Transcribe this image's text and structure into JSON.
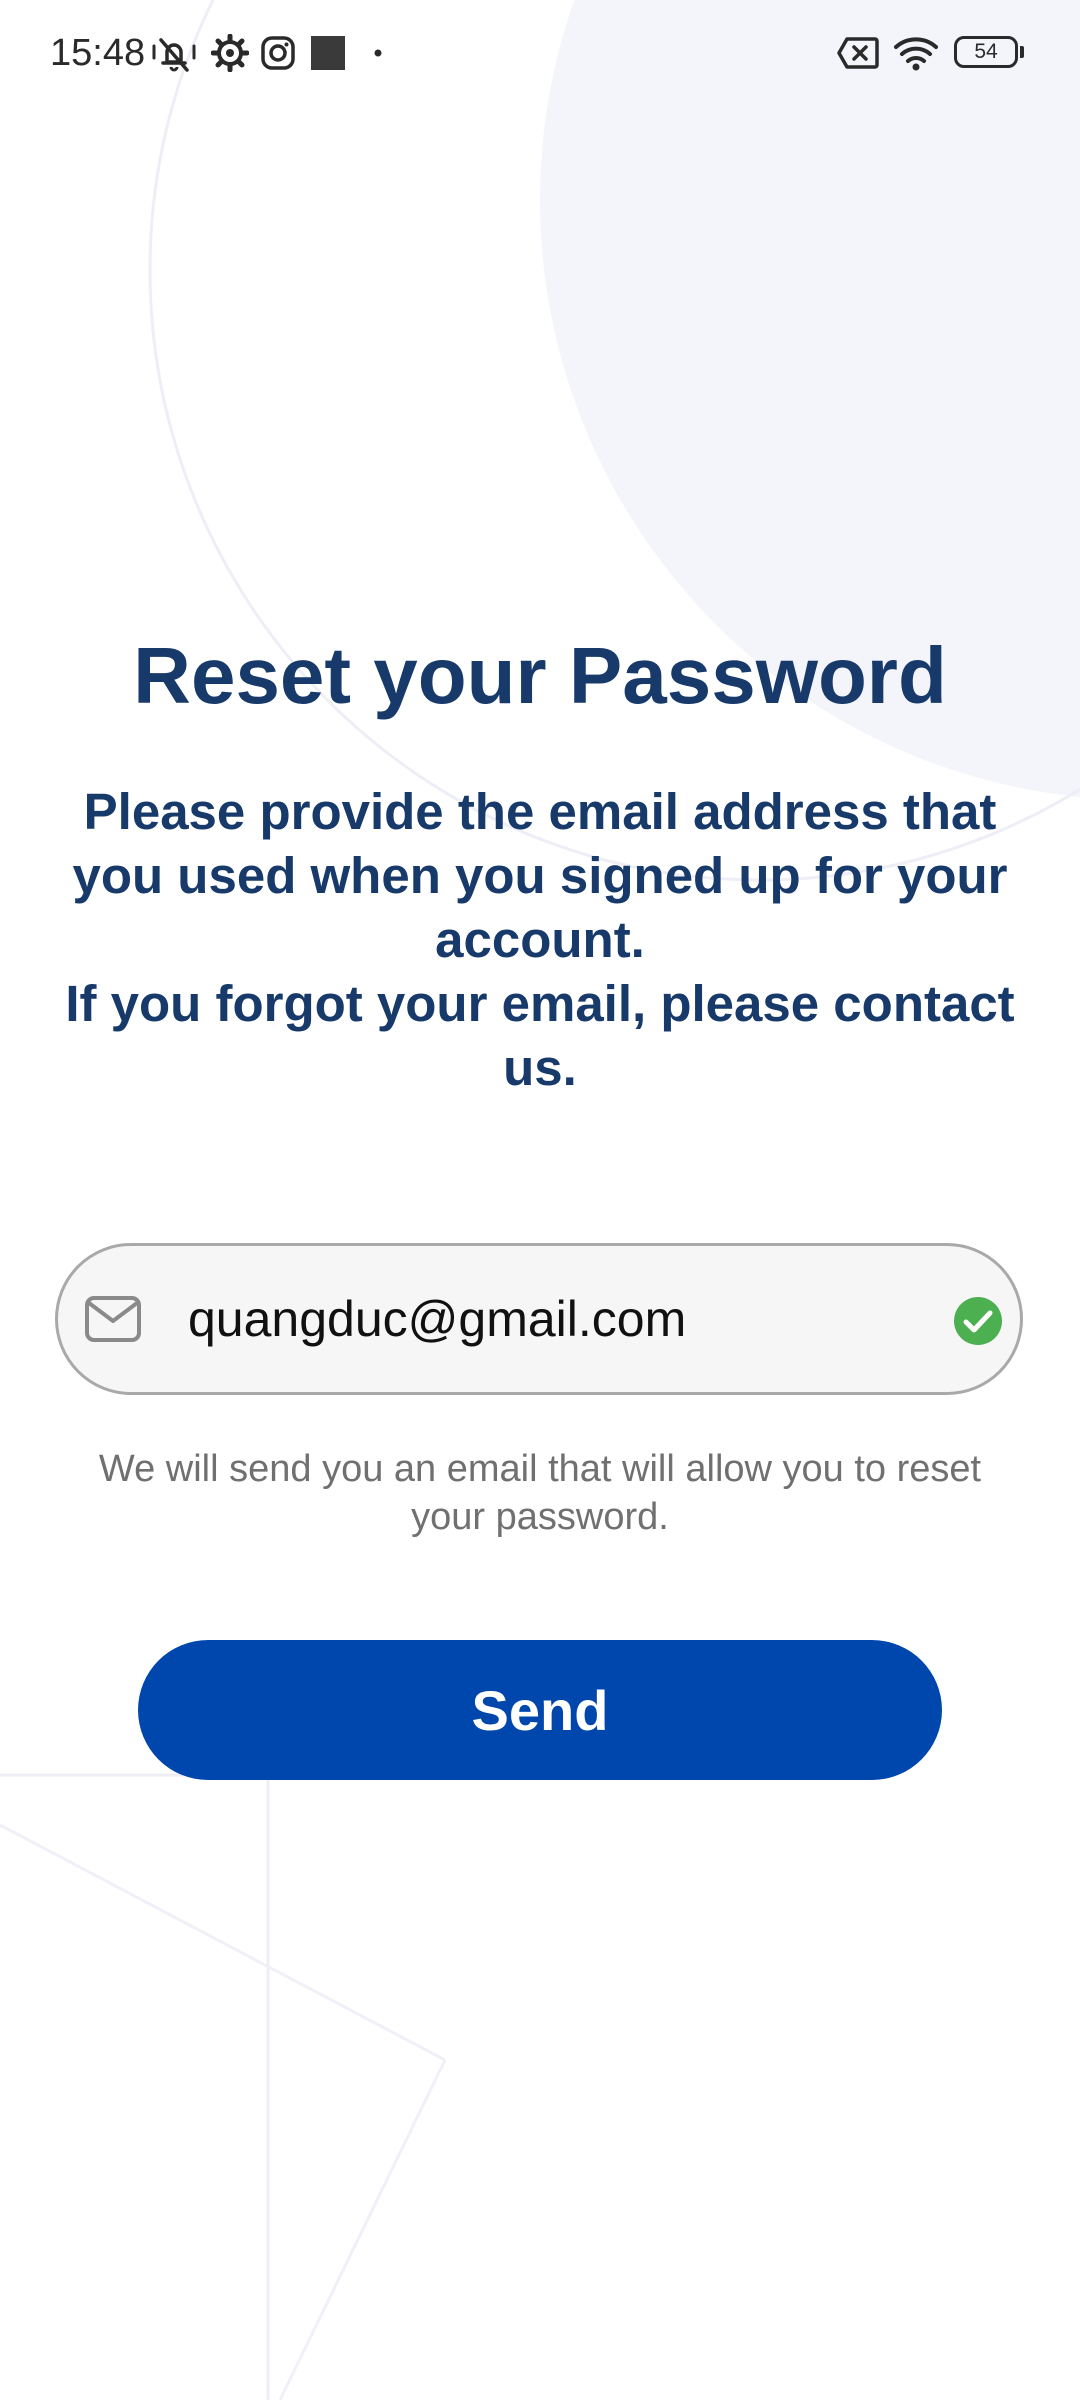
{
  "status_bar": {
    "time": "15:48",
    "battery": "54",
    "icons": [
      "mute-icon",
      "settings-gear-icon",
      "instagram-icon",
      "app-square-icon",
      "dot-icon",
      "battery-saver-icon",
      "wifi-icon",
      "battery-icon"
    ]
  },
  "reset": {
    "title": "Reset your Password",
    "description": "Please provide the email address that you used when you signed up for your account.\nIf you forgot your email, please contact us.",
    "email_value": "quangduc@gmail.com",
    "helper_text": "We will send you an email that will allow you to reset your password.",
    "send_label": "Send"
  },
  "colors": {
    "heading": "#173a6a",
    "primary_button": "#0047ad",
    "field_background": "#f6f6f6",
    "valid_check": "#4caf50",
    "helper_text": "#707070"
  }
}
